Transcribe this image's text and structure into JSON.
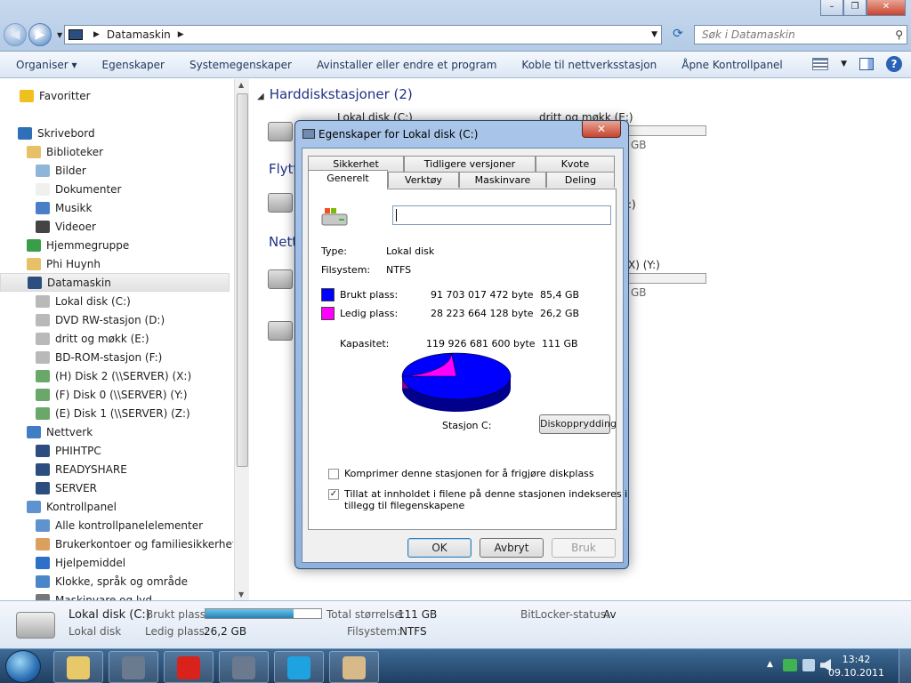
{
  "window": {
    "address_location": "Datamaskin",
    "search_placeholder": "Søk i Datamaskin"
  },
  "toolbar": {
    "organize": "Organiser",
    "properties": "Egenskaper",
    "system_properties": "Systemegenskaper",
    "uninstall": "Avinstaller eller endre et program",
    "map_drive": "Koble til nettverksstasjon",
    "control_panel": "Åpne Kontrollpanel"
  },
  "sidebar": {
    "items": [
      {
        "label": "Favoritter",
        "icon": "star-icon",
        "indent": 0
      },
      {
        "label": "Skrivebord",
        "icon": "desktop-icon",
        "indent": 0
      },
      {
        "label": "Biblioteker",
        "icon": "library-icon",
        "indent": 1
      },
      {
        "label": "Bilder",
        "icon": "pictures-icon",
        "indent": 2
      },
      {
        "label": "Dokumenter",
        "icon": "documents-icon",
        "indent": 2
      },
      {
        "label": "Musikk",
        "icon": "music-icon",
        "indent": 2
      },
      {
        "label": "Videoer",
        "icon": "videos-icon",
        "indent": 2
      },
      {
        "label": "Hjemmegruppe",
        "icon": "homegroup-icon",
        "indent": 1
      },
      {
        "label": "Phi Huynh",
        "icon": "user-folder-icon",
        "indent": 1
      },
      {
        "label": "Datamaskin",
        "icon": "computer-icon",
        "indent": 1
      },
      {
        "label": "Lokal disk (C:)",
        "icon": "drive-icon",
        "indent": 2
      },
      {
        "label": "DVD RW-stasjon (D:)",
        "icon": "dvd-drive-icon",
        "indent": 2
      },
      {
        "label": "dritt og møkk (E:)",
        "icon": "drive-icon",
        "indent": 2
      },
      {
        "label": "BD-ROM-stasjon (F:)",
        "icon": "bd-drive-icon",
        "indent": 2
      },
      {
        "label": "(H) Disk 2 (\\\\SERVER) (X:)",
        "icon": "network-drive-icon",
        "indent": 2
      },
      {
        "label": "(F) Disk 0 (\\\\SERVER) (Y:)",
        "icon": "network-drive-icon",
        "indent": 2
      },
      {
        "label": "(E) Disk 1 (\\\\SERVER) (Z:)",
        "icon": "network-drive-icon",
        "indent": 2
      },
      {
        "label": "Nettverk",
        "icon": "network-icon",
        "indent": 1
      },
      {
        "label": "PHIHTPC",
        "icon": "computer-icon",
        "indent": 2
      },
      {
        "label": "READYSHARE",
        "icon": "computer-icon",
        "indent": 2
      },
      {
        "label": "SERVER",
        "icon": "computer-icon",
        "indent": 2
      },
      {
        "label": "Kontrollpanel",
        "icon": "control-panel-icon",
        "indent": 1
      },
      {
        "label": "Alle kontrollpanelelementer",
        "icon": "control-panel-icon",
        "indent": 2
      },
      {
        "label": "Brukerkontoer og familiesikkerhet",
        "icon": "users-icon",
        "indent": 2
      },
      {
        "label": "Hjelpemiddel",
        "icon": "accessibility-icon",
        "indent": 2
      },
      {
        "label": "Klokke, språk og område",
        "icon": "clock-icon",
        "indent": 2
      },
      {
        "label": "Maskinvare og lyd",
        "icon": "hardware-icon",
        "indent": 2
      }
    ]
  },
  "content": {
    "group_harddisks": "Harddiskstasjoner (2)",
    "drive_c_label": "Lokal disk (C:)",
    "drive_e_label": "dritt og møkk (E:)",
    "drive_e_size_fragment": "GB",
    "group_removable_fragment": "Flytt",
    "group_network_fragment": "Nett",
    "drive_d_fragment": ":)",
    "drive_y_fragment": "X) (Y:)",
    "drive_y_size_fragment": "GB"
  },
  "dialog": {
    "title": "Egenskaper for Lokal disk (C:)",
    "close_glyph": "✕",
    "tabs_back": [
      "Sikkerhet",
      "Tidligere versjoner",
      "Kvote"
    ],
    "tabs_front": [
      "Generelt",
      "Verktøy",
      "Maskinvare",
      "Deling"
    ],
    "name_value": "",
    "type_label": "Type:",
    "type_value": "Lokal disk",
    "fs_label": "Filsystem:",
    "fs_value": "NTFS",
    "used_label": "Brukt plass:",
    "used_bytes": "91 703 017 472 byte",
    "used_gb": "85,4 GB",
    "free_label": "Ledig plass:",
    "free_bytes": "28 223 664 128 byte",
    "free_gb": "26,2 GB",
    "capacity_label": "Kapasitet:",
    "capacity_bytes": "119 926 681 600 byte",
    "capacity_gb": "111 GB",
    "drive_caption": "Stasjon C:",
    "cleanup_button": "Diskopprydding",
    "compress_label": "Komprimer denne stasjonen for å frigjøre diskplass",
    "index_label_line1": "Tillat at innholdet i filene på denne stasjonen indekseres i",
    "index_label_line2": "tillegg til filegenskapene",
    "compress_checked": false,
    "index_checked": true,
    "index_check_glyph": "✓",
    "ok_button": "OK",
    "cancel_button": "Avbryt",
    "apply_button": "Bruk",
    "used_color": "#0000ff",
    "free_color": "#ff00ff",
    "used_fraction": 0.7646
  },
  "details": {
    "drive_name": "Lokal disk (C:)",
    "drive_type": "Lokal disk",
    "used_label": "Brukt plass:",
    "free_label": "Ledig plass:",
    "free_value": "26,2 GB",
    "total_label": "Total størrelse:",
    "total_value": "111 GB",
    "fs_label": "Filsystem:",
    "fs_value": "NTFS",
    "bitlocker_label": "BitLocker-status:",
    "bitlocker_value": "Av",
    "used_fraction": 0.7646
  },
  "taskbar": {
    "time": "13:42",
    "date": "09.10.2011",
    "apps": [
      {
        "name": "explorer-taskbar-button",
        "color": "#e8c96a"
      },
      {
        "name": "starcraft-taskbar-button",
        "color": "#6b7a8f"
      },
      {
        "name": "opera-taskbar-button",
        "color": "#d9221c"
      },
      {
        "name": "starcraft2-taskbar-button",
        "color": "#6b7a8f"
      },
      {
        "name": "skype-taskbar-button",
        "color": "#1fa3e0"
      },
      {
        "name": "paint-taskbar-button",
        "color": "#d7b98a"
      }
    ]
  }
}
